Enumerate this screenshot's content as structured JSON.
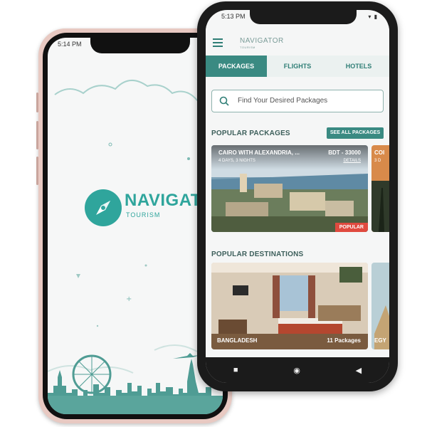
{
  "splash": {
    "status_time": "5:14 PM",
    "brand": "NAVIGATOR",
    "subtitle": "TOURISM"
  },
  "app": {
    "status_time": "5:13 PM",
    "header": {
      "title": "NAVIGATOR",
      "subtitle": "TOURISM"
    },
    "tabs": [
      {
        "label": "PACKAGES",
        "active": true
      },
      {
        "label": "FLIGHTS",
        "active": false
      },
      {
        "label": "HOTELS",
        "active": false
      }
    ],
    "search": {
      "placeholder": "Find Your Desired Packages"
    },
    "popular_packages": {
      "title": "POPULAR PACKAGES",
      "see_all": "SEE ALL PACKAGES",
      "cards": [
        {
          "title": "CAIRO WITH ALEXANDRIA, ...",
          "duration": "4 DAYS, 3 NIGHTS",
          "price": "BDT - 33000",
          "details": "DETAILS",
          "badge": "POPULAR"
        },
        {
          "title": "COI",
          "duration": "3 D"
        }
      ]
    },
    "popular_destinations": {
      "title": "POPULAR DESTINATIONS",
      "cards": [
        {
          "name": "BANGLADESH",
          "count": "11 Packages"
        },
        {
          "name": "EGY"
        }
      ]
    }
  },
  "colors": {
    "brand": "#2fa59c",
    "tab_active": "#3a8a82",
    "badge": "#e04a3f"
  }
}
